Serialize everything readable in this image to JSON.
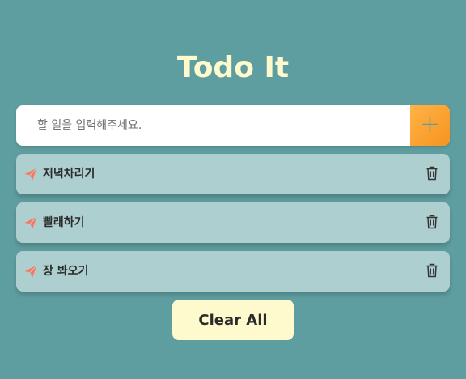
{
  "header": {
    "title": "Todo It"
  },
  "input": {
    "placeholder": "할 일을 입력해주세요.",
    "value": "",
    "add_icon": "plus-icon"
  },
  "todos": [
    {
      "text": "저녁차리기",
      "icon": "paper-plane-icon",
      "delete_icon": "trash-icon"
    },
    {
      "text": "빨래하기",
      "icon": "paper-plane-icon",
      "delete_icon": "trash-icon"
    },
    {
      "text": "장 봐오기",
      "icon": "paper-plane-icon",
      "delete_icon": "trash-icon"
    }
  ],
  "footer": {
    "clear_label": "Clear All"
  },
  "colors": {
    "background": "#5f9ea0",
    "title": "#fffacd",
    "item_bg": "#aecfd0",
    "accent": "#f7931e",
    "icon": "#f9785e"
  }
}
